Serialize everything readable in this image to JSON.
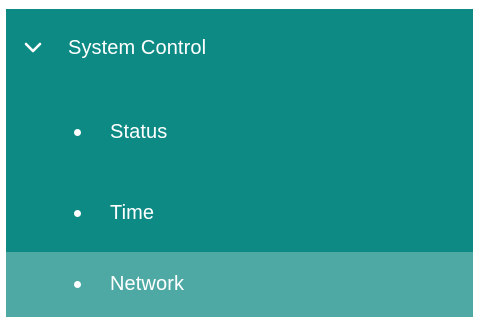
{
  "nav": {
    "group": {
      "label": "System Control",
      "icon": "chevron-down-icon",
      "expanded": true
    },
    "items": [
      {
        "label": "Status",
        "icon": "bullet-icon",
        "selected": false
      },
      {
        "label": "Time",
        "icon": "bullet-icon",
        "selected": false
      },
      {
        "label": "Network",
        "icon": "bullet-icon",
        "selected": true
      }
    ]
  },
  "colors": {
    "panel_background": "#0e8a85",
    "selected_background": "#4ea8a4",
    "text": "#ffffff"
  }
}
